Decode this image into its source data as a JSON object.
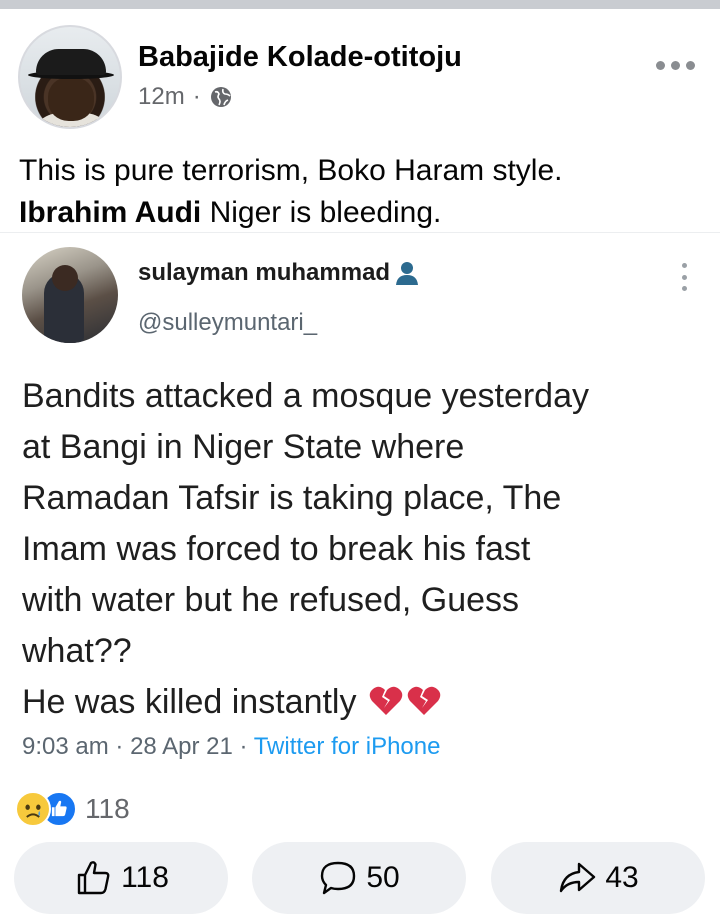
{
  "post": {
    "author": "Babajide Kolade-otitoju",
    "time": "12m",
    "separator": "·",
    "privacy_icon": "globe-icon",
    "text_line1": "This is pure terrorism, Boko Haram style.",
    "mention": "Ibrahim Audi",
    "text_line2_rest": " Niger is bleeding."
  },
  "tweet": {
    "name": "sulayman muhammad",
    "handle": "@sulleymuntari_",
    "lines": [
      "Bandits attacked a mosque yesterday",
      "at Bangi in Niger State where",
      "Ramadan Tafsir is taking place, The",
      "Imam was forced to break his fast",
      "with water but he refused, Guess",
      "what??",
      "He was killed instantly"
    ],
    "time": "9:03 am",
    "date": "28 Apr 21",
    "source": "Twitter for iPhone"
  },
  "reactions": {
    "count": "118",
    "icons": [
      "sad-icon",
      "like-icon"
    ]
  },
  "actions": {
    "like_count": "118",
    "comment_count": "50",
    "share_count": "43"
  },
  "colors": {
    "accent": "#1877f2",
    "twitter_blue": "#1d9bf0",
    "secondary_text": "#65676b",
    "button_bg": "#eef0f3"
  }
}
